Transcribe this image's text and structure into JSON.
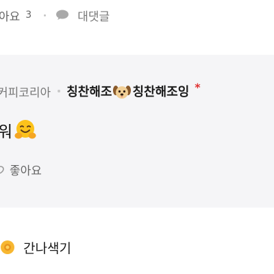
{
  "comment_actions": {
    "like_label": "아요",
    "like_count": "3",
    "reply_label": "대댓글",
    "icons": {
      "reply": "speech-bubble-icon"
    }
  },
  "reply": {
    "cafe_name": "커피코리아",
    "author_part1": "칭찬해조",
    "author_part2": "칭찬해조잉",
    "author_icon": "dog-face-icon",
    "required_mark": "*",
    "text": "워",
    "text_icon": "hugging-face-icon",
    "like_label": "좋아요"
  },
  "next_comment": {
    "author": "간나색기",
    "avatar_icon": "sunflower-badge-icon"
  },
  "colors": {
    "reply_background": "#f5f5f7",
    "muted_text": "#777777",
    "required_mark": "#e03030"
  }
}
